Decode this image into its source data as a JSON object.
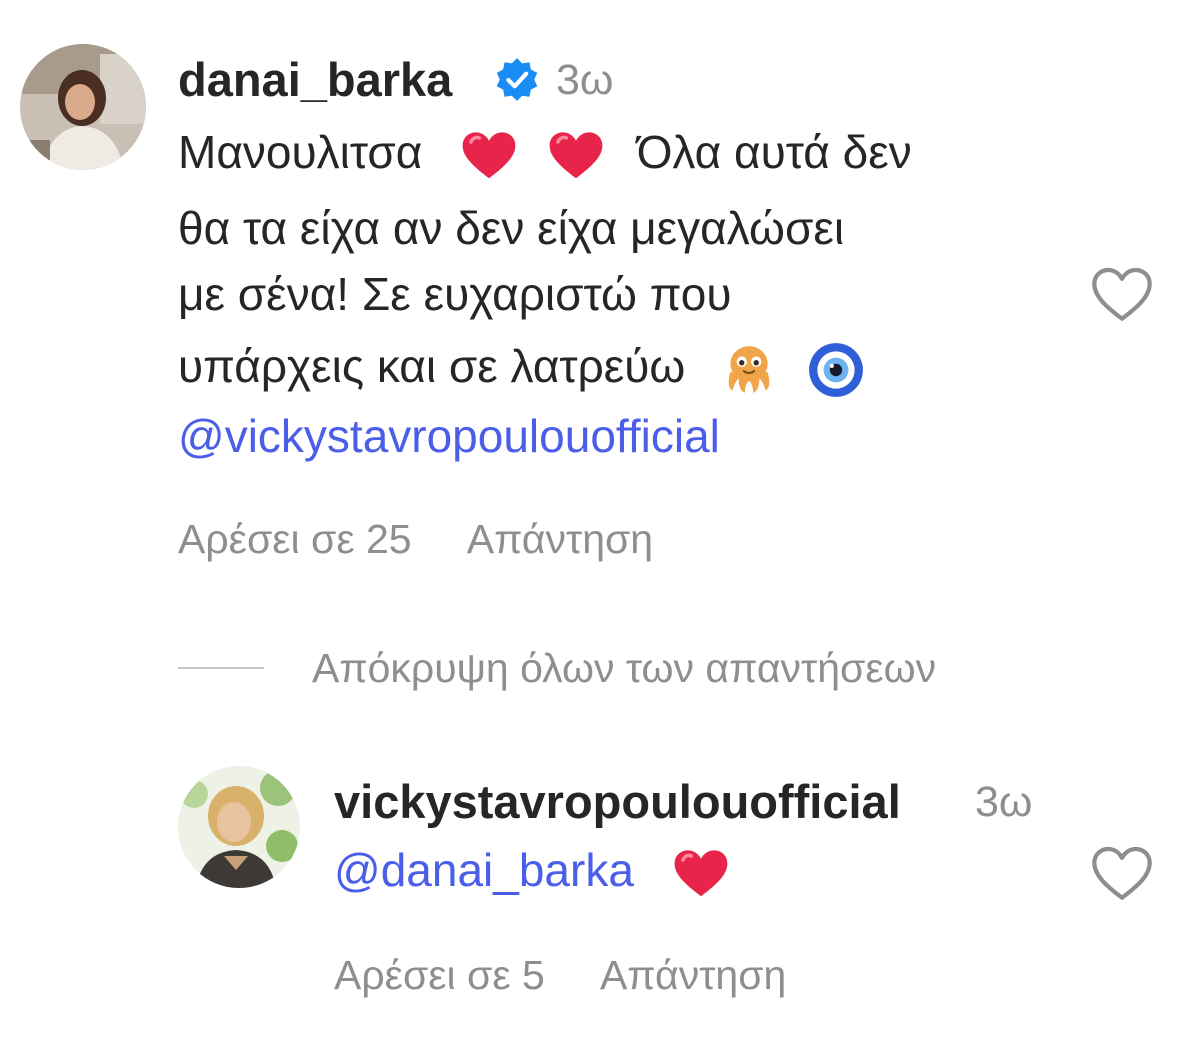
{
  "comment": {
    "username": "danai_barka",
    "verified_icon": "verified-badge-icon",
    "time": "3ω",
    "lines": [
      {
        "pre": "Μανουλιτσα",
        "post": "Όλα αυτά δεν"
      },
      {
        "text": "θα τα είχα αν δεν είχα μεγαλώσει"
      },
      {
        "text": "με σένα! Σε ευχαριστώ που"
      },
      {
        "pre": "υπάρχεις και σε λατρεύω"
      }
    ],
    "mention": "@vickystavropoulouofficial",
    "likes": "Αρέσει σε 25",
    "reply": "Απάντηση",
    "emojis": [
      "red-heart-icon",
      "red-heart-icon",
      "octopus-icon",
      "nazar-amulet-icon"
    ]
  },
  "hide_replies": "Απόκρυψη όλων των απαντήσεων",
  "reply_comment": {
    "username": "vickystavropoulouofficial",
    "time": "3ω",
    "mention": "@danai_barka",
    "likes": "Αρέσει σε 5",
    "reply": "Απάντηση",
    "emojis": [
      "red-heart-icon"
    ]
  },
  "colors": {
    "text": "#262626",
    "muted": "#8e8e8e",
    "mention": "#4a5ee8",
    "verified": "#1a8cf5",
    "heart": "#e8244a"
  }
}
